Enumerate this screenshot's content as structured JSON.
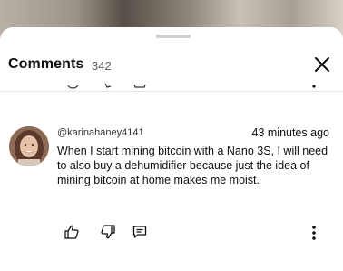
{
  "sheet": {
    "title": "Comments",
    "count": "342"
  },
  "icons": {
    "close": "close-icon",
    "like": "thumbs-up-icon",
    "dislike": "thumbs-down-icon",
    "reply": "reply-icon",
    "more": "more-vertical-icon"
  },
  "comment": {
    "author": "@karinahaney4141",
    "time": "43 minutes ago",
    "text": "When I start mining bitcoin with a Nano 3S, I will need to also buy a dehumidifier because just the idea of mining bitcoin at home makes me moist."
  }
}
